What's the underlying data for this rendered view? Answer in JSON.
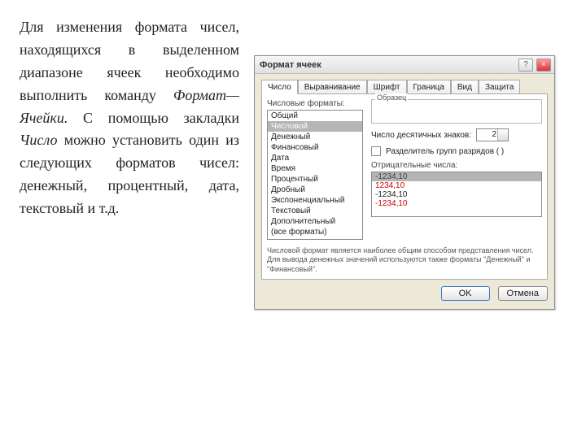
{
  "prose": {
    "seg1": "Для изменения формата чисел, находящихся в выделенном диапазоне ячеек необходимо выполнить команду ",
    "cmd": "Формат—Ячейки.",
    "seg2": " С помощью закладки ",
    "tab": "Число",
    "seg3": " можно установить один из следующих форматов чисел: денежный, процентный, дата, текстовый и т.д."
  },
  "dialog": {
    "title": "Формат ячеек",
    "help": "?",
    "close": "×",
    "tabs": [
      "Число",
      "Выравнивание",
      "Шрифт",
      "Граница",
      "Вид",
      "Защита"
    ],
    "formats_label": "Числовые форматы:",
    "formats": [
      "Общий",
      "Числовой",
      "Денежный",
      "Финансовый",
      "Дата",
      "Время",
      "Процентный",
      "Дробный",
      "Экспоненциальный",
      "Текстовый",
      "Дополнительный",
      "(все форматы)"
    ],
    "sample_label": "Образец",
    "decimals_label": "Число десятичных знаков:",
    "decimals_value": "2",
    "sep_label": "Разделитель групп разрядов ( )",
    "neg_label": "Отрицательные числа:",
    "neg_items": [
      "-1234,10",
      "1234,10",
      "-1234,10",
      "-1234,10"
    ],
    "description": "Числовой формат является наиболее общим способом представления чисел. Для вывода денежных значений используются также форматы \"Денежный\" и \"Финансовый\".",
    "ok": "OK",
    "cancel": "Отмена"
  }
}
